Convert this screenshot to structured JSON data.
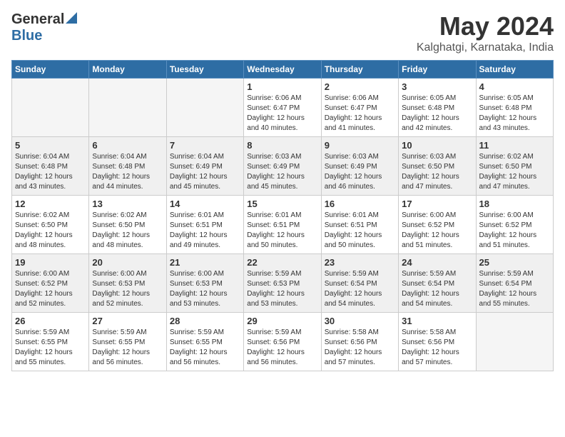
{
  "header": {
    "logo_general": "General",
    "logo_blue": "Blue",
    "title": "May 2024",
    "location": "Kalghatgi, Karnataka, India"
  },
  "days_of_week": [
    "Sunday",
    "Monday",
    "Tuesday",
    "Wednesday",
    "Thursday",
    "Friday",
    "Saturday"
  ],
  "weeks": [
    {
      "shaded": false,
      "days": [
        {
          "num": "",
          "empty": true
        },
        {
          "num": "",
          "empty": true
        },
        {
          "num": "",
          "empty": true
        },
        {
          "num": "1",
          "sunrise": "6:06 AM",
          "sunset": "6:47 PM",
          "daylight": "12 hours and 40 minutes."
        },
        {
          "num": "2",
          "sunrise": "6:06 AM",
          "sunset": "6:47 PM",
          "daylight": "12 hours and 41 minutes."
        },
        {
          "num": "3",
          "sunrise": "6:05 AM",
          "sunset": "6:48 PM",
          "daylight": "12 hours and 42 minutes."
        },
        {
          "num": "4",
          "sunrise": "6:05 AM",
          "sunset": "6:48 PM",
          "daylight": "12 hours and 43 minutes."
        }
      ]
    },
    {
      "shaded": true,
      "days": [
        {
          "num": "5",
          "sunrise": "6:04 AM",
          "sunset": "6:48 PM",
          "daylight": "12 hours and 43 minutes."
        },
        {
          "num": "6",
          "sunrise": "6:04 AM",
          "sunset": "6:48 PM",
          "daylight": "12 hours and 44 minutes."
        },
        {
          "num": "7",
          "sunrise": "6:04 AM",
          "sunset": "6:49 PM",
          "daylight": "12 hours and 45 minutes."
        },
        {
          "num": "8",
          "sunrise": "6:03 AM",
          "sunset": "6:49 PM",
          "daylight": "12 hours and 45 minutes."
        },
        {
          "num": "9",
          "sunrise": "6:03 AM",
          "sunset": "6:49 PM",
          "daylight": "12 hours and 46 minutes."
        },
        {
          "num": "10",
          "sunrise": "6:03 AM",
          "sunset": "6:50 PM",
          "daylight": "12 hours and 47 minutes."
        },
        {
          "num": "11",
          "sunrise": "6:02 AM",
          "sunset": "6:50 PM",
          "daylight": "12 hours and 47 minutes."
        }
      ]
    },
    {
      "shaded": false,
      "days": [
        {
          "num": "12",
          "sunrise": "6:02 AM",
          "sunset": "6:50 PM",
          "daylight": "12 hours and 48 minutes."
        },
        {
          "num": "13",
          "sunrise": "6:02 AM",
          "sunset": "6:50 PM",
          "daylight": "12 hours and 48 minutes."
        },
        {
          "num": "14",
          "sunrise": "6:01 AM",
          "sunset": "6:51 PM",
          "daylight": "12 hours and 49 minutes."
        },
        {
          "num": "15",
          "sunrise": "6:01 AM",
          "sunset": "6:51 PM",
          "daylight": "12 hours and 50 minutes."
        },
        {
          "num": "16",
          "sunrise": "6:01 AM",
          "sunset": "6:51 PM",
          "daylight": "12 hours and 50 minutes."
        },
        {
          "num": "17",
          "sunrise": "6:00 AM",
          "sunset": "6:52 PM",
          "daylight": "12 hours and 51 minutes."
        },
        {
          "num": "18",
          "sunrise": "6:00 AM",
          "sunset": "6:52 PM",
          "daylight": "12 hours and 51 minutes."
        }
      ]
    },
    {
      "shaded": true,
      "days": [
        {
          "num": "19",
          "sunrise": "6:00 AM",
          "sunset": "6:52 PM",
          "daylight": "12 hours and 52 minutes."
        },
        {
          "num": "20",
          "sunrise": "6:00 AM",
          "sunset": "6:53 PM",
          "daylight": "12 hours and 52 minutes."
        },
        {
          "num": "21",
          "sunrise": "6:00 AM",
          "sunset": "6:53 PM",
          "daylight": "12 hours and 53 minutes."
        },
        {
          "num": "22",
          "sunrise": "5:59 AM",
          "sunset": "6:53 PM",
          "daylight": "12 hours and 53 minutes."
        },
        {
          "num": "23",
          "sunrise": "5:59 AM",
          "sunset": "6:54 PM",
          "daylight": "12 hours and 54 minutes."
        },
        {
          "num": "24",
          "sunrise": "5:59 AM",
          "sunset": "6:54 PM",
          "daylight": "12 hours and 54 minutes."
        },
        {
          "num": "25",
          "sunrise": "5:59 AM",
          "sunset": "6:54 PM",
          "daylight": "12 hours and 55 minutes."
        }
      ]
    },
    {
      "shaded": false,
      "days": [
        {
          "num": "26",
          "sunrise": "5:59 AM",
          "sunset": "6:55 PM",
          "daylight": "12 hours and 55 minutes."
        },
        {
          "num": "27",
          "sunrise": "5:59 AM",
          "sunset": "6:55 PM",
          "daylight": "12 hours and 56 minutes."
        },
        {
          "num": "28",
          "sunrise": "5:59 AM",
          "sunset": "6:55 PM",
          "daylight": "12 hours and 56 minutes."
        },
        {
          "num": "29",
          "sunrise": "5:59 AM",
          "sunset": "6:56 PM",
          "daylight": "12 hours and 56 minutes."
        },
        {
          "num": "30",
          "sunrise": "5:58 AM",
          "sunset": "6:56 PM",
          "daylight": "12 hours and 57 minutes."
        },
        {
          "num": "31",
          "sunrise": "5:58 AM",
          "sunset": "6:56 PM",
          "daylight": "12 hours and 57 minutes."
        },
        {
          "num": "",
          "empty": true
        }
      ]
    }
  ]
}
